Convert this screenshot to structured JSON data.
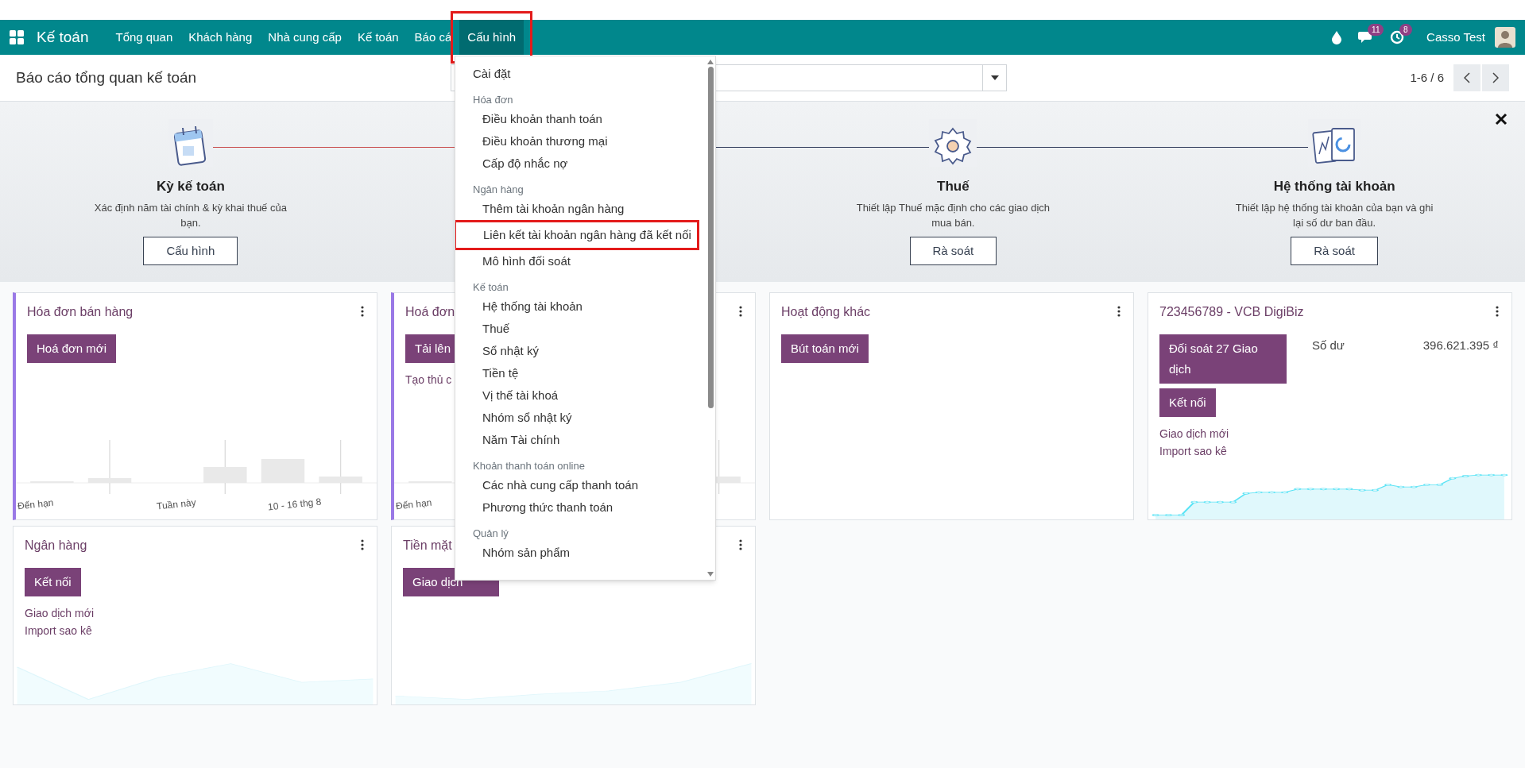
{
  "navbar": {
    "brand": "Kế toán",
    "items": [
      {
        "label": "Tổng quan",
        "selected": false,
        "highlighted": false
      },
      {
        "label": "Khách hàng",
        "selected": false,
        "highlighted": false
      },
      {
        "label": "Nhà cung cấp",
        "selected": false,
        "highlighted": false
      },
      {
        "label": "Kế toán",
        "selected": false,
        "highlighted": false
      },
      {
        "label": "Báo cá",
        "selected": false,
        "highlighted": false
      },
      {
        "label": "Cấu hình",
        "selected": true,
        "highlighted": true
      }
    ],
    "chat_count": "11",
    "activity_count": "8",
    "user": "Casso Test"
  },
  "control_panel": {
    "title": "Báo cáo tổng quan kế toán",
    "pager": "1-6 / 6"
  },
  "onboarding": {
    "steps": [
      {
        "title": "Kỳ kế toán",
        "description": "Xác định năm tài chính & kỳ khai thuế của bạn.",
        "button": "Cấu hình",
        "done": true
      },
      {
        "title": "Thuế",
        "description": "Thiết lập Thuế mặc định cho các giao dịch mua bán.",
        "button": "Rà soát",
        "done": false
      },
      {
        "title": "Hệ thống tài khoản",
        "description": "Thiết lập hệ thống tài khoản của bạn và ghi lại số dư ban đầu.",
        "button": "Rà soát"
      }
    ]
  },
  "dropdown": {
    "entries": [
      {
        "kind": "item",
        "label": "Cài đặt",
        "highlighted": false,
        "top": true
      },
      {
        "kind": "header",
        "label": "Hóa đơn"
      },
      {
        "kind": "item",
        "label": "Điều khoản thanh toán",
        "highlighted": false
      },
      {
        "kind": "item",
        "label": "Điều khoản thương mại",
        "highlighted": false
      },
      {
        "kind": "item",
        "label": "Cấp độ nhắc nợ",
        "highlighted": false
      },
      {
        "kind": "header",
        "label": "Ngân hàng"
      },
      {
        "kind": "item",
        "label": "Thêm tài khoản ngân hàng",
        "highlighted": false
      },
      {
        "kind": "item",
        "label": "Liên kết tài khoản ngân hàng đã kết nối",
        "highlighted": true
      },
      {
        "kind": "item",
        "label": "Mô hình đối soát",
        "highlighted": false
      },
      {
        "kind": "header",
        "label": "Kế toán"
      },
      {
        "kind": "item",
        "label": "Hệ thống tài khoản",
        "highlighted": false
      },
      {
        "kind": "item",
        "label": "Thuế",
        "highlighted": false
      },
      {
        "kind": "item",
        "label": "Sổ nhật ký",
        "highlighted": false
      },
      {
        "kind": "item",
        "label": "Tiền tệ",
        "highlighted": false
      },
      {
        "kind": "item",
        "label": "Vị thế tài khoá",
        "highlighted": false
      },
      {
        "kind": "item",
        "label": "Nhóm sổ nhật ký",
        "highlighted": false
      },
      {
        "kind": "item",
        "label": "Năm Tài chính",
        "highlighted": false
      },
      {
        "kind": "header",
        "label": "Khoản thanh toán online"
      },
      {
        "kind": "item",
        "label": "Các nhà cung cấp thanh toán",
        "highlighted": false
      },
      {
        "kind": "item",
        "label": "Phương thức thanh toán",
        "highlighted": false
      },
      {
        "kind": "header",
        "label": "Quản lý"
      },
      {
        "kind": "item",
        "label": "Nhóm sản phẩm",
        "highlighted": false
      }
    ]
  },
  "cards": [
    {
      "kind": "sales",
      "title": "Hóa đơn bán hàng",
      "accent": true,
      "buttons": [
        "Hoá đơn mới"
      ],
      "chart_labels": [
        "Đến hạn",
        "Tuần này",
        "10 - 16 thg 8"
      ]
    },
    {
      "kind": "sales",
      "title": "Hoá đơn",
      "accent": true,
      "buttons": [
        "Tải lên"
      ],
      "links": [
        "Tạo thủ c"
      ],
      "chart_labels": [
        "Đến hạn"
      ]
    },
    {
      "kind": "general",
      "title": "Hoạt động khác",
      "accent": false,
      "buttons": [
        "Bút toán mới"
      ]
    },
    {
      "kind": "bank",
      "title": "723456789 - VCB DigiBiz",
      "accent": false,
      "buttons": [
        "Đối soát 27 Giao dịch",
        "Kết nối"
      ],
      "links": [
        "Giao dịch mới",
        "Import sao kê"
      ],
      "balance": {
        "label": "Số dư",
        "value": "396.621.395 ₫"
      }
    },
    {
      "kind": "bank-empty",
      "title": "Ngân hàng",
      "accent": false,
      "buttons": [
        "Kết nối"
      ],
      "links": [
        "Giao dịch mới",
        "Import sao kê"
      ]
    },
    {
      "kind": "cash",
      "title": "Tiền mặt",
      "accent": false,
      "buttons": [
        "Giao dịch"
      ]
    }
  ]
}
